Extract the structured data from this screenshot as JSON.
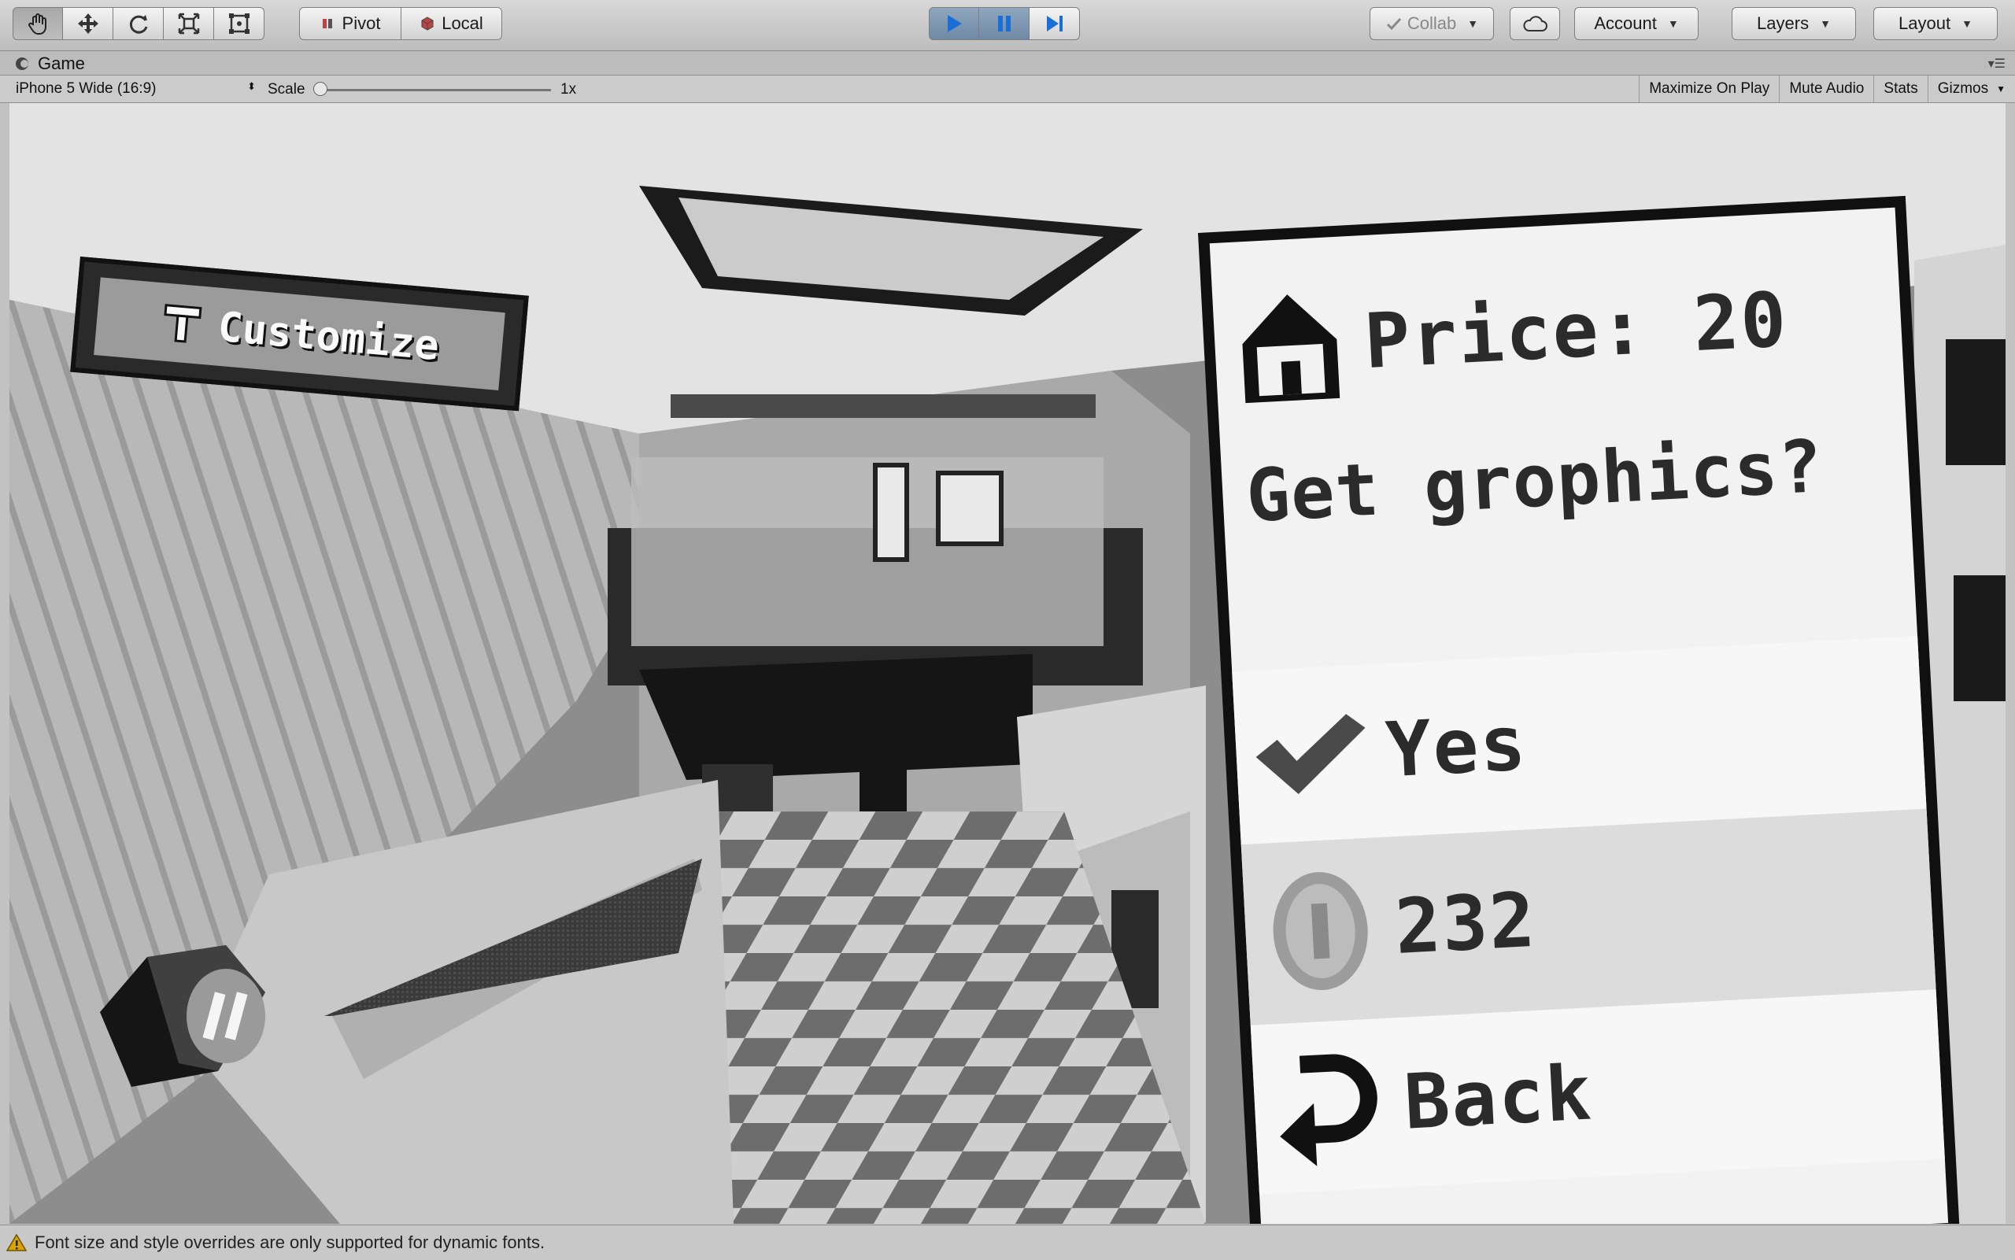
{
  "toolbar": {
    "tools": [
      {
        "name": "hand-tool",
        "icon": "hand-icon"
      },
      {
        "name": "move-tool",
        "icon": "move-icon"
      },
      {
        "name": "rotate-tool",
        "icon": "rotate-icon"
      },
      {
        "name": "scale-tool",
        "icon": "scale-icon"
      },
      {
        "name": "rect-tool",
        "icon": "rect-transform-icon"
      }
    ],
    "pivot_label": "Pivot",
    "local_label": "Local",
    "play_controls": [
      "play-icon",
      "pause-icon",
      "step-icon"
    ],
    "collab_label": "Collab",
    "account_label": "Account",
    "layers_label": "Layers",
    "layout_label": "Layout"
  },
  "tab": {
    "title": "Game"
  },
  "game_bar": {
    "resolution": "iPhone 5 Wide (16:9)",
    "scale_label": "Scale",
    "scale_value": "1x",
    "maximize_label": "Maximize On Play",
    "mute_label": "Mute Audio",
    "stats_label": "Stats",
    "gizmos_label": "Gizmos"
  },
  "game": {
    "customize_label": "Customize",
    "dialog": {
      "price_label": "Price: 20",
      "question": "Get grophics?",
      "yes_label": "Yes",
      "coins": "232",
      "back_label": "Back"
    }
  },
  "status": {
    "message": "Font size and style overrides are only supported for dynamic fonts."
  },
  "colors": {
    "play_active": "#6f8aa6",
    "warning": "#d9a400"
  }
}
